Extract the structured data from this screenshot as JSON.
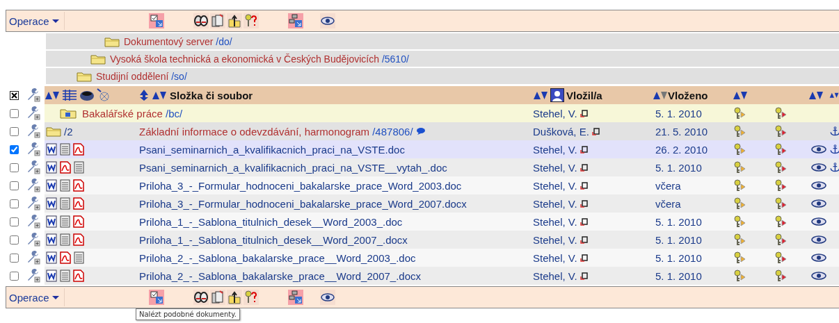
{
  "toolbars": [
    {
      "menu": "Operace"
    },
    {
      "menu": "Operace",
      "tooltip": "Nalézt podobné dokumenty."
    }
  ],
  "breadcrumbs": [
    {
      "name": "Dokumentový server",
      "path": "/do/"
    },
    {
      "name": "Vysoká škola technická a ekonomická v Českých Budějovicích",
      "path": "/5610/"
    },
    {
      "name": "Studijní oddělení",
      "path": "/so/"
    }
  ],
  "header": {
    "name": "Složka či soubor",
    "author": "Vložil/a",
    "date": "Vloženo"
  },
  "rows": [
    {
      "kind": "folder",
      "checked": false,
      "selected": false,
      "icons": [],
      "name": "Bakalářské práce",
      "path": "/bc/",
      "author": "Stehel, V.",
      "date": "5. 1. 2010",
      "preview": false,
      "anchor": false
    },
    {
      "kind": "link",
      "checked": false,
      "selected": false,
      "icons": [],
      "prefix": "/2",
      "name": "Základní informace o odevzdávání, harmonogram",
      "path": "/487806/",
      "comment": true,
      "author": "Dušková, E.",
      "date": "21. 5. 2010",
      "preview": false,
      "anchor": true
    },
    {
      "kind": "file",
      "checked": true,
      "selected": true,
      "icons": [
        {
          "kind": "word"
        },
        {
          "kind": "text"
        },
        {
          "kind": "pdf"
        }
      ],
      "name": "Psani_seminarnich_a_kvalifikacnich_praci_na_VSTE.doc",
      "author": "Stehel, V.",
      "date": "26. 2. 2010",
      "preview": true,
      "anchor": true
    },
    {
      "kind": "file",
      "checked": false,
      "selected": false,
      "icons": [
        {
          "kind": "word"
        },
        {
          "kind": "pdf"
        },
        {
          "kind": "text"
        }
      ],
      "name": "Psani_seminarnich_a_kvalifikacnich_praci_na_VSTE__vytah_.doc",
      "author": "Stehel, V.",
      "date": "5. 1. 2010",
      "preview": true,
      "anchor": true
    },
    {
      "kind": "file",
      "checked": false,
      "selected": false,
      "icons": [
        {
          "kind": "word"
        },
        {
          "kind": "text"
        },
        {
          "kind": "pdf"
        }
      ],
      "name": "Priloha_3_-_Formular_hodnoceni_bakalarske_prace_Word_2003.doc",
      "author": "Stehel, V.",
      "date": "včera",
      "preview": true,
      "anchor": false
    },
    {
      "kind": "file",
      "checked": false,
      "selected": false,
      "icons": [
        {
          "kind": "word"
        },
        {
          "kind": "text"
        },
        {
          "kind": "pdf"
        }
      ],
      "name": "Priloha_3_-_Formular_hodnoceni_bakalarske_prace_Word_2007.docx",
      "author": "Stehel, V.",
      "date": "včera",
      "preview": true,
      "anchor": false
    },
    {
      "kind": "file",
      "checked": false,
      "selected": false,
      "icons": [
        {
          "kind": "word"
        },
        {
          "kind": "text"
        },
        {
          "kind": "pdf"
        }
      ],
      "name": "Priloha_1_-_Sablona_titulnich_desek__Word_2003_.doc",
      "author": "Stehel, V.",
      "date": "5. 1. 2010",
      "preview": true,
      "anchor": false
    },
    {
      "kind": "file",
      "checked": false,
      "selected": false,
      "icons": [
        {
          "kind": "word"
        },
        {
          "kind": "text"
        },
        {
          "kind": "pdf"
        }
      ],
      "name": "Priloha_1_-_Sablona_titulnich_desek__Word_2007_.docx",
      "author": "Stehel, V.",
      "date": "5. 1. 2010",
      "preview": true,
      "anchor": false
    },
    {
      "kind": "file",
      "checked": false,
      "selected": false,
      "icons": [
        {
          "kind": "word"
        },
        {
          "kind": "pdf"
        },
        {
          "kind": "text"
        }
      ],
      "name": "Priloha_2_-_Sablona_bakalarske_prace__Word_2003_.doc",
      "author": "Stehel, V.",
      "date": "5. 1. 2010",
      "preview": true,
      "anchor": false
    },
    {
      "kind": "file",
      "checked": false,
      "selected": false,
      "icons": [
        {
          "kind": "word"
        },
        {
          "kind": "text"
        },
        {
          "kind": "pdf"
        }
      ],
      "name": "Priloha_2_-_Sablona_bakalarske_prace__Word_2007_.docx",
      "author": "Stehel, V.",
      "date": "5. 1. 2010",
      "preview": true,
      "anchor": false
    }
  ]
}
